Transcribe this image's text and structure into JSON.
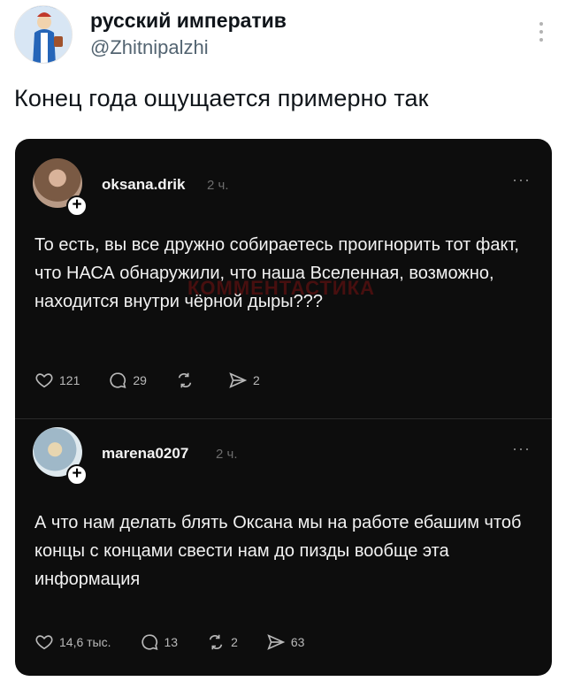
{
  "tweet": {
    "author_name": "русский императив",
    "author_handle": "@Zhitnipalzhi",
    "text": "Конец года ощущается примерно так"
  },
  "thread_posts": [
    {
      "username": "oksana.drik",
      "time": "2 ч.",
      "text": "То есть, вы все дружно собираетесь проигнорить тот факт, что НАСА обнаружили, что наша Вселенная, возможно, находится внутри чёрной дыры???",
      "likes": "121",
      "comments": "29",
      "reposts": "",
      "shares": "2"
    },
    {
      "username": "marena0207",
      "time": "2 ч.",
      "text": "А что нам делать блять  Оксана мы на работе ебашим чтоб концы с концами свести нам до пизды вообще эта информация",
      "likes": "14,6 тыс.",
      "comments": "13",
      "reposts": "2",
      "shares": "63"
    }
  ],
  "watermark": "КОММЕНТАСТИКА",
  "plus_symbol": "+",
  "more_dots": "···",
  "colors": {
    "card_bg": "#0d0d0d",
    "text_dark": "#0f1419",
    "handle_gray": "#536471"
  }
}
